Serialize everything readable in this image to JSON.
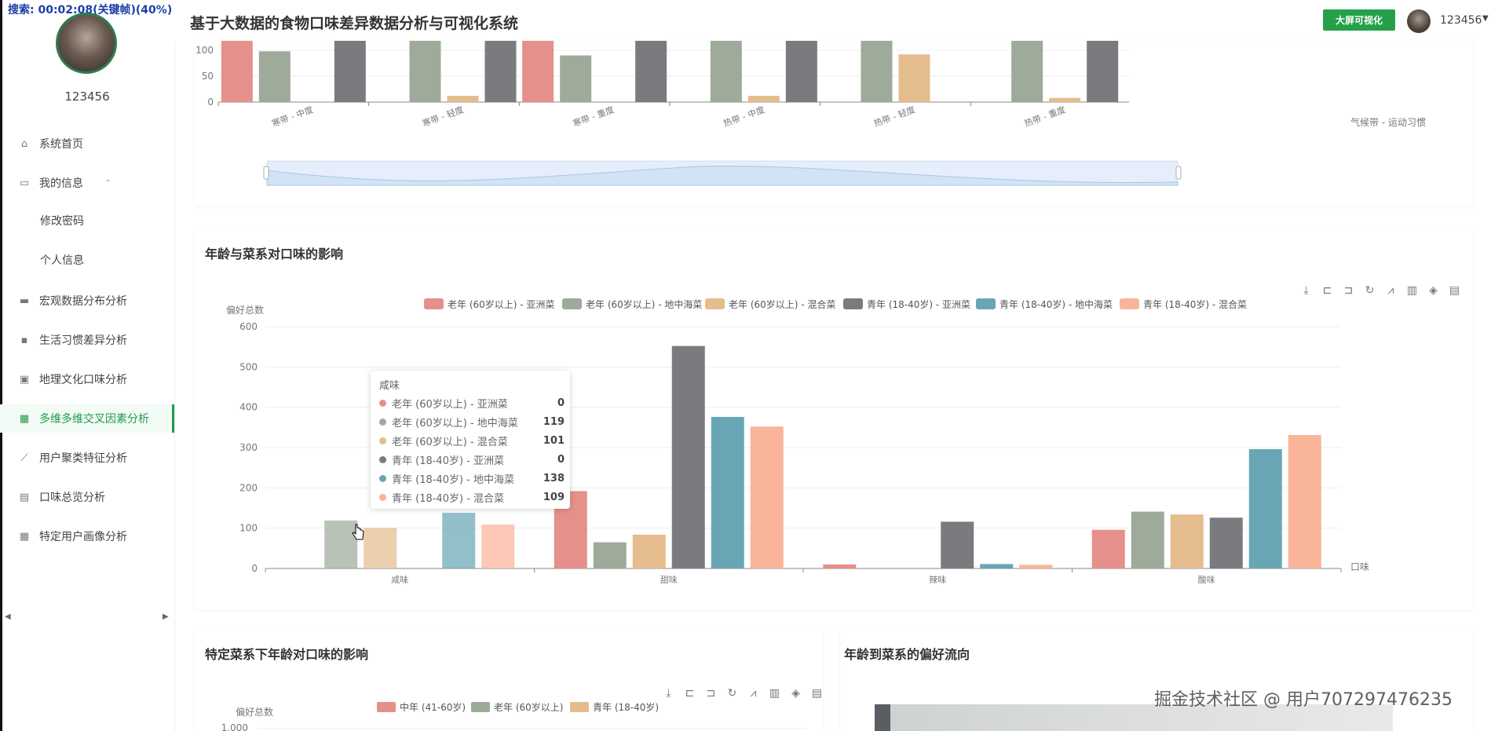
{
  "recording_tag": "搜索: 00:02:08(关键帧)(40%)",
  "sidebar": {
    "username": "123456",
    "items": [
      {
        "label": "系统首页",
        "icon": "home-icon"
      },
      {
        "label": "我的信息",
        "icon": "idcard-icon"
      },
      {
        "label": "修改密码"
      },
      {
        "label": "个人信息"
      },
      {
        "label": "宏观数据分布分析",
        "icon": "briefcase-icon"
      },
      {
        "label": "生活习惯差异分析",
        "icon": "chat-icon"
      },
      {
        "label": "地理文化口味分析",
        "icon": "clipboard-check-icon"
      },
      {
        "label": "多维多维交叉因素分析",
        "icon": "grid-icon"
      },
      {
        "label": "用户聚类特征分析",
        "icon": "line-chart-icon"
      },
      {
        "label": "口味总览分析",
        "icon": "document-icon"
      },
      {
        "label": "特定用户画像分析",
        "icon": "grid-icon"
      }
    ]
  },
  "header": {
    "title": "基于大数据的食物口味差异数据分析与可视化系统",
    "bigscreen_label": "大屏可视化",
    "user": "123456"
  },
  "colors": {
    "accent": "#24a148",
    "series": [
      "#e5908a",
      "#9eaa9a",
      "#e5bc8e",
      "#7a7b7f",
      "#68a6b6",
      "#f9b49a"
    ]
  },
  "charts": {
    "top": {
      "x_axis_label": "气候带 - 运动习惯",
      "y_ticks": [
        "0",
        "50",
        "100"
      ]
    },
    "age_cuisine": {
      "title": "年龄与菜系对口味的影响",
      "y_axis_name": "偏好总数",
      "x_axis_name": "口味",
      "y_ticks": [
        "0",
        "100",
        "200",
        "300",
        "400",
        "500",
        "600"
      ]
    },
    "cuisine_age": {
      "title": "特定菜系下年龄对口味的影响",
      "y_axis_name": "偏好总数",
      "y_top_tick": "1,000",
      "legend": [
        "中年 (41-60岁)",
        "老年 (60岁以上)",
        "青年 (18-40岁)"
      ]
    },
    "age_flow": {
      "title": "年龄到菜系的偏好流向"
    }
  },
  "chart_data": [
    {
      "type": "bar",
      "categories": [
        "寒带 - 中度",
        "寒带 - 轻度",
        "寒带 - 重度",
        "热带 - 中度",
        "热带 - 轻度",
        "热带 - 重度"
      ],
      "ylim": [
        0,
        150
      ],
      "xlabel": "气候带 - 运动习惯",
      "series": [
        {
          "values": [
            140,
            null,
            124,
            null,
            null,
            null
          ]
        },
        {
          "values": [
            98,
            140,
            90,
            140,
            140,
            140
          ]
        },
        {
          "values": [
            null,
            12,
            null,
            12,
            92,
            8
          ]
        },
        {
          "values": [
            140,
            140,
            140,
            140,
            null,
            130
          ]
        }
      ]
    },
    {
      "type": "bar",
      "title": "年龄与菜系对口味的影响",
      "categories": [
        "咸味",
        "甜味",
        "辣味",
        "酸味"
      ],
      "xlabel": "口味",
      "ylabel": "偏好总数",
      "ylim": [
        0,
        600
      ],
      "legend_position": "top",
      "series": [
        {
          "name": "老年 (60岁以上) - 亚洲菜",
          "values": [
            0,
            192,
            10,
            96
          ]
        },
        {
          "name": "老年 (60岁以上) - 地中海菜",
          "values": [
            119,
            65,
            0,
            141
          ]
        },
        {
          "name": "老年 (60岁以上) - 混合菜",
          "values": [
            101,
            84,
            0,
            134
          ]
        },
        {
          "name": "青年 (18-40岁) - 亚洲菜",
          "values": [
            0,
            552,
            116,
            126
          ]
        },
        {
          "name": "青年 (18-40岁) - 地中海菜",
          "values": [
            138,
            376,
            11,
            296
          ]
        },
        {
          "name": "青年 (18-40岁) - 混合菜",
          "values": [
            109,
            352,
            9,
            331
          ]
        }
      ]
    }
  ],
  "tooltip": {
    "title": "咸味",
    "rows": [
      {
        "name": "老年 (60岁以上) - 亚洲菜",
        "value": "0"
      },
      {
        "name": "老年 (60岁以上) - 地中海菜",
        "value": "119"
      },
      {
        "name": "老年 (60岁以上) - 混合菜",
        "value": "101"
      },
      {
        "name": "青年 (18-40岁) - 亚洲菜",
        "value": "0"
      },
      {
        "name": "青年 (18-40岁) - 地中海菜",
        "value": "138"
      },
      {
        "name": "青年 (18-40岁) - 混合菜",
        "value": "109"
      }
    ]
  },
  "watermark": "掘金技术社区 @ 用户707297476235"
}
